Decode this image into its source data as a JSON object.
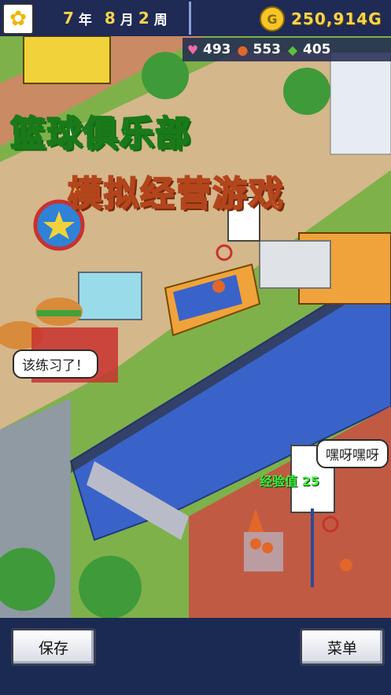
{
  "header": {
    "weather_icon": "sunflower-icon",
    "year_value": "7",
    "year_label": "年",
    "month_value": "8",
    "month_label": "月",
    "week_value": "2",
    "week_label": "周",
    "money_icon": "coin-icon",
    "money_value": "250,914G"
  },
  "stats": [
    {
      "icon": "heart-icon",
      "value": "493",
      "color": "#f06aa6"
    },
    {
      "icon": "basketball-icon",
      "value": "553",
      "color": "#e2672a"
    },
    {
      "icon": "frog-icon",
      "value": "405",
      "color": "#5cc23a"
    }
  ],
  "banner": {
    "title_line1": "篮球俱乐部",
    "title_line2": "模拟经营游戏"
  },
  "speech": {
    "left_bubble": "该练习了！",
    "right_bubble": "嘿呀嘿呀"
  },
  "xp_label": "经验值 25",
  "buttons": {
    "save_label": "保存",
    "menu_label": "菜单"
  },
  "colors": {
    "title_green": "#39c94a",
    "title_orange": "#f3c64a",
    "bar_bg": "#1b2a52",
    "gold": "#f7d44a"
  }
}
